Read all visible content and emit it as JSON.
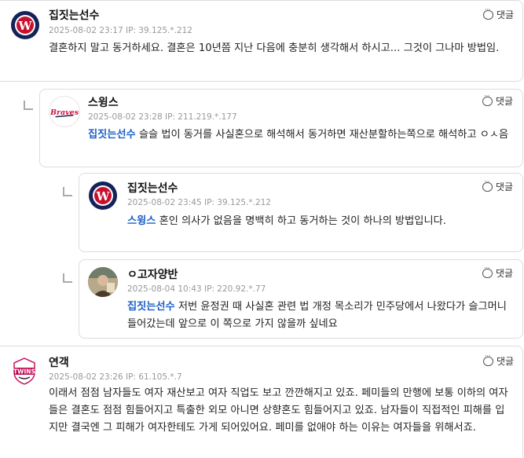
{
  "comments": [
    {
      "nickname": "집짓는선수",
      "timestamp": "2025-08-02 23:17",
      "ip": "IP: 39.125.*.212",
      "reply_label": "댓글",
      "avatar": "nationals-logo",
      "mention": "",
      "text": "결혼하지 말고 동거하세요. 결혼은 10년쯤 지난 다음에 충분히 생각해서 하시고... 그것이 그나마 방법임."
    },
    {
      "nickname": "스윙스",
      "timestamp": "2025-08-02 23:28",
      "ip": "IP: 211.219.*.177",
      "reply_label": "댓글",
      "avatar": "braves-logo",
      "mention": "집짓는선수",
      "text": " 슬슬 법이 동거를 사실혼으로 해석해서 동거하면 재산분할하는쪽으로 해석하고 ㅇㅅ음"
    },
    {
      "nickname": "집짓는선수",
      "timestamp": "2025-08-02 23:45",
      "ip": "IP: 39.125.*.212",
      "reply_label": "댓글",
      "avatar": "nationals-logo",
      "mention": "스윙스",
      "text": " 혼인 의사가 없음을 명백히 하고 동거하는 것이 하나의 방법입니다."
    },
    {
      "nickname": "ㅇ고자양반",
      "timestamp": "2025-08-04 10:43",
      "ip": "IP: 220.92.*.77",
      "reply_label": "댓글",
      "avatar": "user-photo",
      "mention": "집짓는선수",
      "text": " 저번 윤정권 때 사실혼 관련 법 개정 목소리가 민주당에서 나왔다가 슬그머니 들어갔는데 앞으로 이 쪽으로 가지 않을까 싶네요"
    },
    {
      "nickname": "연객",
      "timestamp": "2025-08-02 23:26",
      "ip": "IP: 61.105.*.7",
      "reply_label": "댓글",
      "avatar": "twins-logo",
      "mention": "",
      "text": "이래서 점점 남자들도 여자 재산보고 여자 직업도 보고 깐깐해지고 있죠. 페미들의 만행에 보통 이하의 여자들은 결혼도 점점 힘들어지고 특출한 외모 아니면 상향혼도 힘들어지고 있죠. 남자들이 직접적인 피해를 입지만 결국엔 그 피해가 여자한테도 가게 되어있어요. 페미를 없애야 하는 이유는 여자들을 위해서죠."
    }
  ],
  "logos": {
    "nationals_text": "W",
    "braves_text": "Braves",
    "twins_text": "TWINS"
  }
}
